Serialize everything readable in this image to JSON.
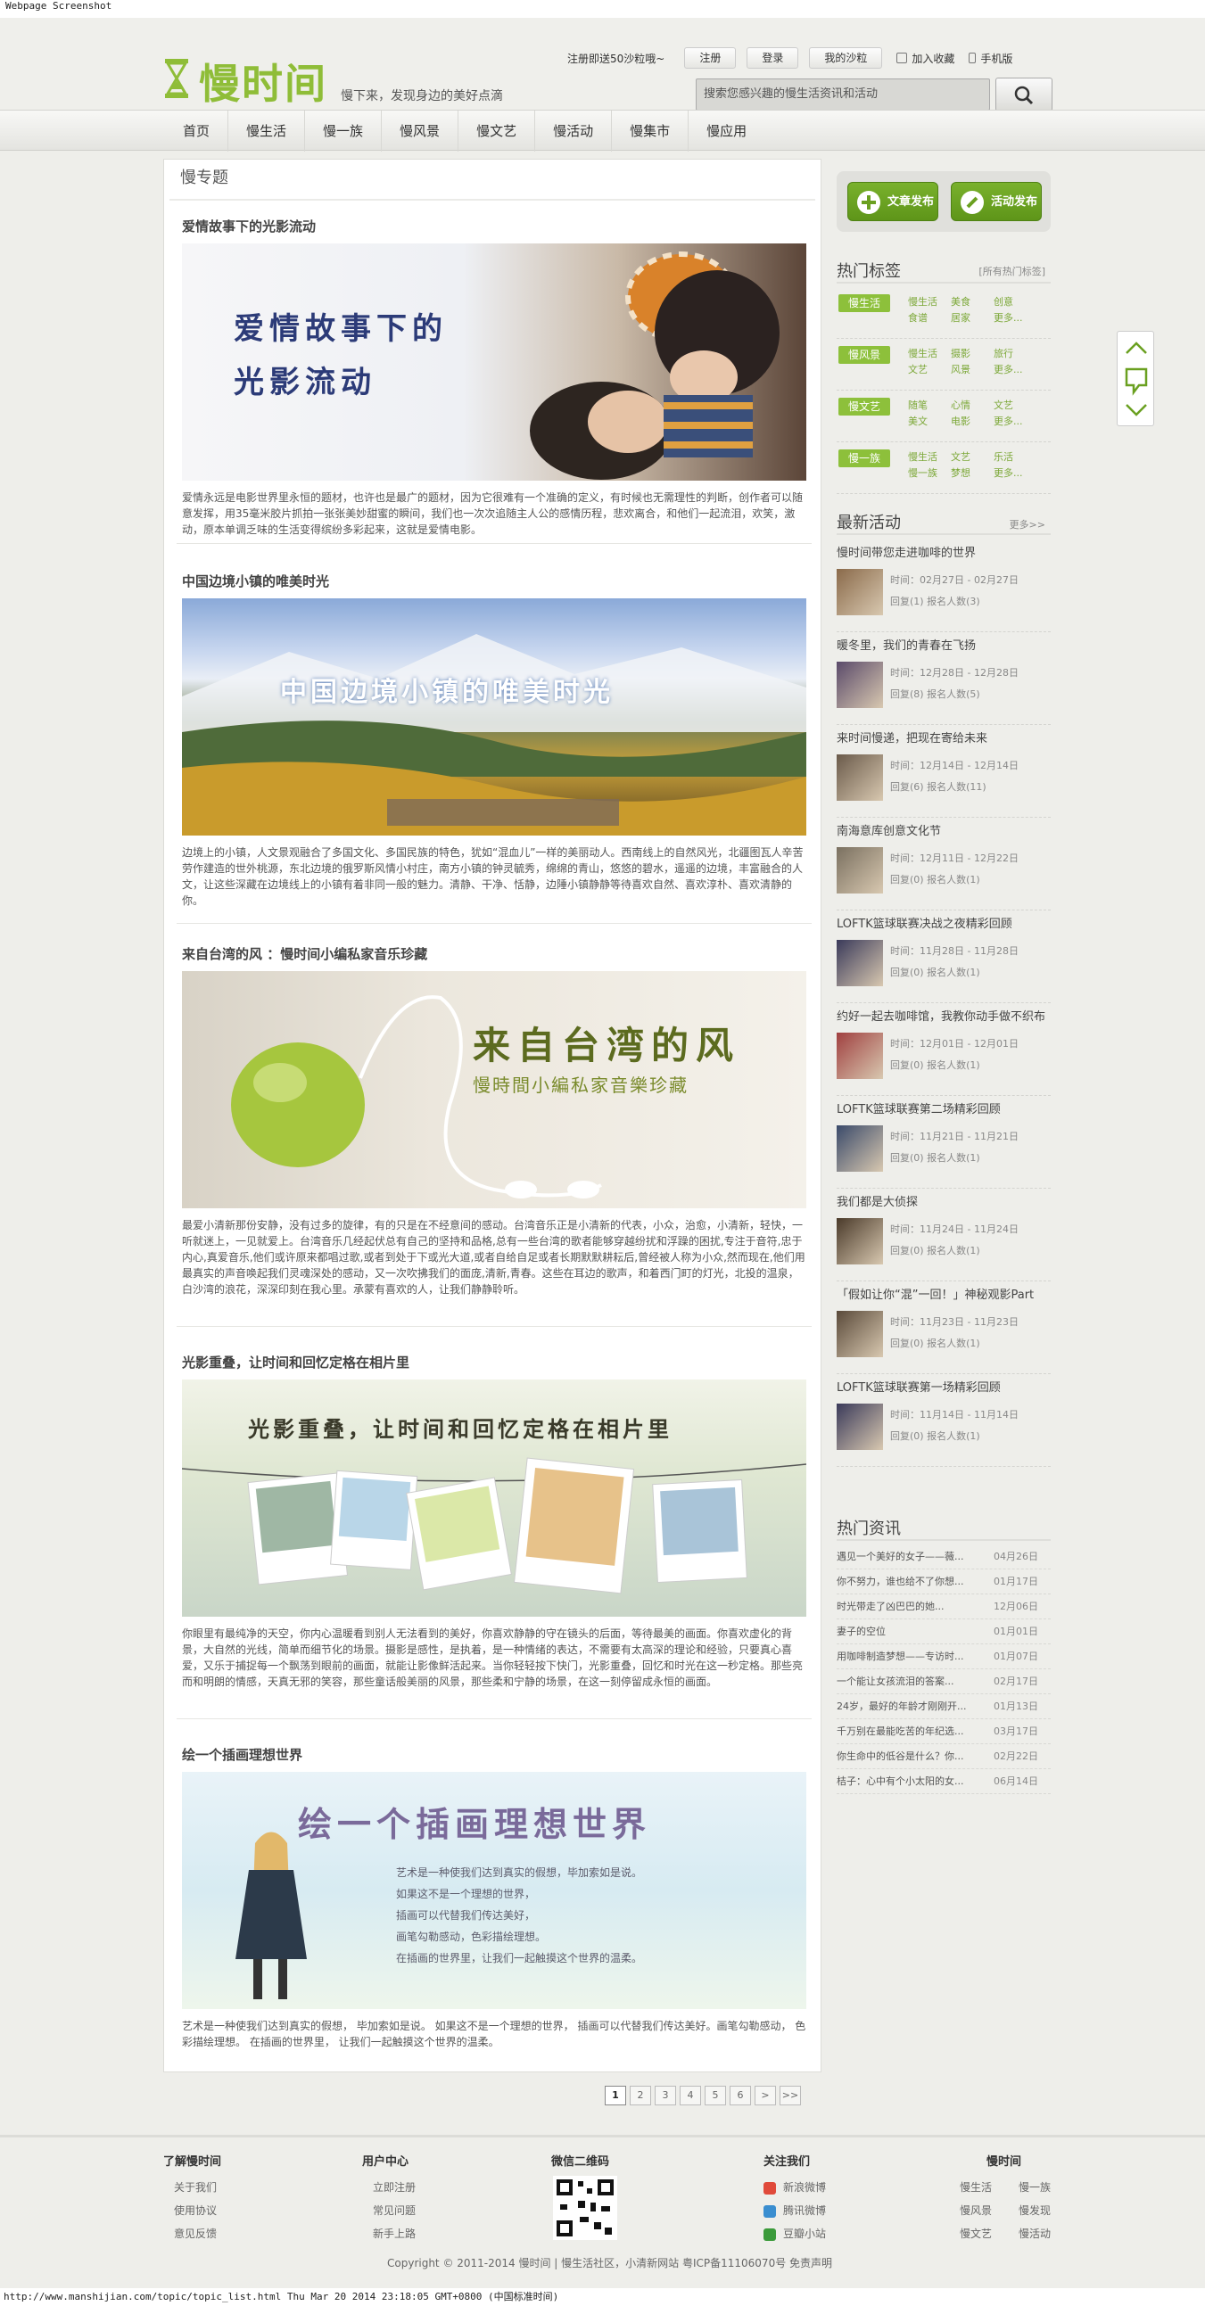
{
  "capture_header": "Webpage Screenshot",
  "capture_footer": "http://www.manshijian.com/topic/topic_list.html Thu Mar 20 2014 23:18:05 GMT+0800 (中国标准时间)",
  "brand": {
    "logo_text": "慢时间",
    "slogan": "慢下来，发现身边的美好点滴",
    "accent": "#8fbd38"
  },
  "toplinks": {
    "promo": "注册即送50沙粒哦~",
    "register": "注册",
    "login": "登录",
    "my_sand": "我的沙粒",
    "favorite": "加入收藏",
    "mobile": "手机版"
  },
  "search": {
    "placeholder": "搜索您感兴趣的慢生活资讯和活动"
  },
  "nav": [
    "首页",
    "慢生活",
    "慢一族",
    "慢风景",
    "慢文艺",
    "慢活动",
    "慢集市",
    "慢应用"
  ],
  "main": {
    "title": "慢专题",
    "posts": [
      {
        "title": "爱情故事下的光影流动",
        "image_text": [
          "爱情故事下的",
          "光影流动"
        ],
        "desc": "爱情永远是电影世界里永恒的题材，也许也是最广的题材，因为它很难有一个准确的定义，有时候也无需理性的判断，创作者可以随意发挥，用35毫米胶片抓拍一张张美妙甜蜜的瞬间，我们也一次次追随主人公的感情历程，悲欢离合，和他们一起流泪，欢笑，激动，原本单调乏味的生活变得缤纷多彩起来，这就是爱情电影。"
      },
      {
        "title": "中国边境小镇的唯美时光",
        "image_text": [
          "中国边境小镇的唯美时光"
        ],
        "desc": "边境上的小镇，人文景观融合了多国文化、多国民族的特色，犹如“混血儿”一样的美丽动人。西南线上的自然风光，北疆图瓦人辛苦劳作建造的世外桃源，东北边境的俄罗斯风情小村庄，南方小镇的钟灵毓秀，绵绵的青山，悠悠的碧水，遥遥的边境，丰富融合的人文，让这些深藏在边境线上的小镇有着非同一般的魅力。清静、干净、恬静，边陲小镇静静等待喜欢自然、喜欢淳朴、喜欢清静的你。"
      },
      {
        "title": "来自台湾的风 ：慢时间小编私家音乐珍藏",
        "image_text": [
          "来自台湾的风",
          "慢時間小編私家音樂珍藏"
        ],
        "desc": "最爱小清新那份安静，没有过多的旋律，有的只是在不经意间的感动。台湾音乐正是小清新的代表，小众，治愈，小清新，轻快，一听就迷上，一见就爱上。台湾音乐几经起伏总有自己的坚持和品格,总有一些台湾的歌者能够穿越纷扰和浮躁的困扰,专注于音符,忠于内心,真爱音乐,他们或许原来都唱过歌,或者到处于下或光大道,或者自给自足或者长期默默耕耘后,曾经被人称为小众,然而现在,他们用最真实的声音唤起我们灵魂深处的感动，又一次吹拂我们的面庞,清新,青春。这些在耳边的歌声，和着西门町的灯光，北投的温泉，白沙湾的浪花，深深印刻在我心里。承蒙有喜欢的人，让我们静静聆听。"
      },
      {
        "title": "光影重叠，让时间和回忆定格在相片里",
        "image_text": [
          "光影重叠，让时间和回忆定格在相片里"
        ],
        "desc": "你眼里有最纯净的天空，你内心温暖看到别人无法看到的美好，你喜欢静静的守在镜头的后面，等待最美的画面。你喜欢虚化的背景，大自然的光线，简单而细节化的场景。摄影是感性，是执着，是一种情绪的表达，不需要有太高深的理论和经验，只要真心喜爱，又乐于捕捉每一个飘荡到眼前的画面，就能让影像鲜活起来。当你轻轻按下快门，光影重叠，回忆和时光在这一秒定格。那些亮而和明朗的情感，天真无邪的笑容，那些童话般美丽的风景，那些柔和宁静的场景，在这一刻停留成永恒的画面。"
      },
      {
        "title": "绘一个插画理想世界",
        "image_text": [
          "绘一个插画理想世界",
          "艺术是一种使我们达到真实的假想，毕加索如是说。",
          "如果这不是一个理想的世界，",
          "插画可以代替我们传达美好，",
          "画笔勾勒感动，色彩描绘理想。",
          "在插画的世界里，让我们一起触摸这个世界的温柔。"
        ],
        "desc": "艺术是一种使我们达到真实的假想， 毕加索如是说。 如果这不是一个理想的世界， 插画可以代替我们传达美好。画笔勾勒感动， 色彩描绘理想。 在插画的世界里， 让我们一起触摸这个世界的温柔。"
      }
    ]
  },
  "pager": [
    "1",
    "2",
    "3",
    "4",
    "5",
    "6",
    ">",
    ">>"
  ],
  "side": {
    "publish_article": "文章发布",
    "publish_event": "活动发布",
    "hot_tags_title": "热门标签",
    "hot_tags_more": "[所有热门标签]",
    "tag_groups": [
      {
        "badge": "慢生活",
        "tags": [
          "慢生活",
          "美食",
          "创意",
          "食谱",
          "居家",
          "更多..."
        ]
      },
      {
        "badge": "慢风景",
        "tags": [
          "慢生活",
          "摄影",
          "旅行",
          "文艺",
          "风景",
          "更多..."
        ]
      },
      {
        "badge": "慢文艺",
        "tags": [
          "随笔",
          "心情",
          "文艺",
          "美文",
          "电影",
          "更多..."
        ]
      },
      {
        "badge": "慢一族",
        "tags": [
          "慢生活",
          "文艺",
          "乐活",
          "慢一族",
          "梦想",
          "更多..."
        ]
      }
    ],
    "activities_title": "最新活动",
    "activities_more": "更多>>",
    "activities": [
      {
        "title": "慢时间带您走进咖啡的世界",
        "time": "时间：02月27日 - 02月27日",
        "stats": "回复(1) 报名人数(3)"
      },
      {
        "title": "暖冬里，我们的青春在飞扬",
        "time": "时间：12月28日 - 12月28日",
        "stats": "回复(8) 报名人数(5)"
      },
      {
        "title": "来时间慢递，把现在寄给未来",
        "time": "时间：12月14日 - 12月14日",
        "stats": "回复(6) 报名人数(11)"
      },
      {
        "title": "南海意库创意文化节",
        "time": "时间：12月11日 - 12月22日",
        "stats": "回复(0) 报名人数(1)"
      },
      {
        "title": "LOFTK篮球联赛决战之夜精彩回顾",
        "time": "时间：11月28日 - 11月28日",
        "stats": "回复(0) 报名人数(1)"
      },
      {
        "title": "约好一起去咖啡馆，我教你动手做不织布",
        "time": "时间：12月01日 - 12月01日",
        "stats": "回复(0) 报名人数(1)"
      },
      {
        "title": "LOFTK篮球联赛第二场精彩回顾",
        "time": "时间：11月21日 - 11月21日",
        "stats": "回复(0) 报名人数(1)"
      },
      {
        "title": "我们都是大侦探",
        "time": "时间：11月24日 - 11月24日",
        "stats": "回复(0) 报名人数(1)"
      },
      {
        "title": "「假如让你“混”一回！」神秘观影Part",
        "time": "时间：11月23日 - 11月23日",
        "stats": "回复(0) 报名人数(1)"
      },
      {
        "title": "LOFTK篮球联赛第一场精彩回顾",
        "time": "时间：11月14日 - 11月14日",
        "stats": "回复(0) 报名人数(1)"
      }
    ],
    "news_title": "热门资讯",
    "news": [
      {
        "title": "遇见一个美好的女子——薇...",
        "date": "04月26日"
      },
      {
        "title": "你不努力，谁也给不了你想...",
        "date": "01月17日"
      },
      {
        "title": "时光带走了凶巴巴的她...",
        "date": "12月06日"
      },
      {
        "title": "妻子的空位",
        "date": "01月01日"
      },
      {
        "title": "用咖啡制造梦想——专访时...",
        "date": "01月07日"
      },
      {
        "title": "一个能让女孩流泪的答案...",
        "date": "02月17日"
      },
      {
        "title": "24岁，最好的年龄才刚刚开...",
        "date": "01月13日"
      },
      {
        "title": "千万别在最能吃苦的年纪选...",
        "date": "03月17日"
      },
      {
        "title": "你生命中的低谷是什么？你...",
        "date": "02月22日"
      },
      {
        "title": "桔子：心中有个小太阳的女...",
        "date": "06月14日"
      }
    ]
  },
  "footer": {
    "cols": [
      {
        "head": "了解慢时间",
        "links": [
          "关于我们",
          "使用协议",
          "意见反馈"
        ]
      },
      {
        "head": "用户中心",
        "links": [
          "立即注册",
          "常见问题",
          "新手上路"
        ]
      },
      {
        "head": "微信二维码",
        "links": []
      },
      {
        "head": "关注我们",
        "links": [
          "新浪微博",
          "腾讯微博",
          "豆瓣小站"
        ]
      },
      {
        "head": "慢时间",
        "links": [
          "慢生活",
          "慢一族",
          "慢风景",
          "慢发现",
          "慢文艺",
          "慢活动"
        ]
      }
    ],
    "copyright": "Copyright © 2011-2014 慢时间 | 慢生活社区，小清新网站 粤ICP备11106070号    免责声明"
  }
}
